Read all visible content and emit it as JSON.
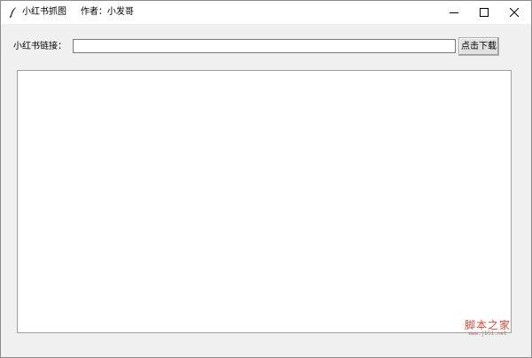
{
  "window": {
    "title": "小红书抓图     作者：小发哥",
    "app_icon": "feather-icon",
    "controls": {
      "minimize": "minimize-icon",
      "maximize": "maximize-icon",
      "close": "close-icon"
    }
  },
  "form": {
    "url_label": "小红书链接：",
    "url_value": "",
    "download_label": "点击下载"
  },
  "output": {
    "text": ""
  },
  "watermark": {
    "main": "脚本之家",
    "sub": "www.jb51.net"
  }
}
